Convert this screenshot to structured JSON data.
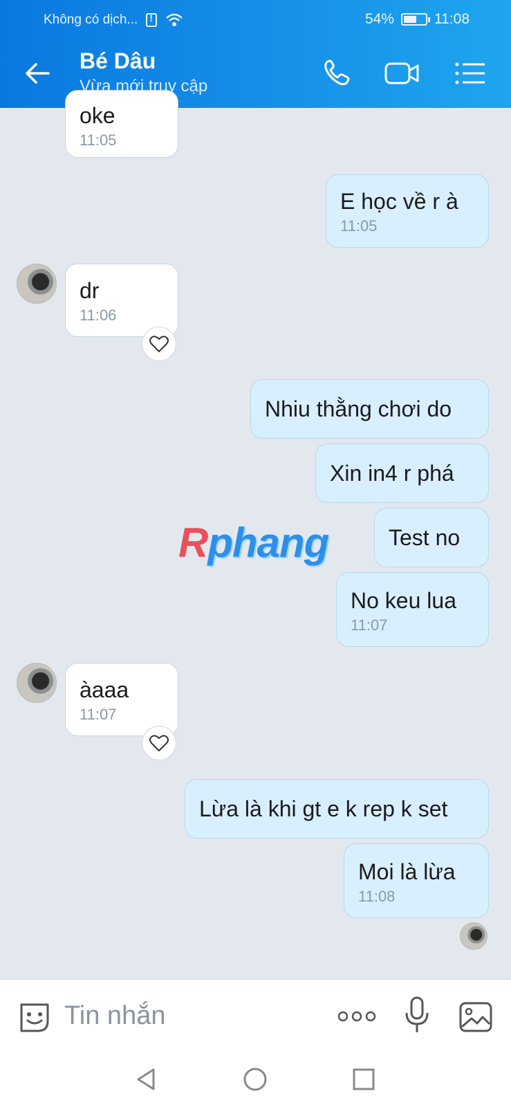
{
  "status_bar": {
    "carrier": "Không có dịch...",
    "battery": "54%",
    "time": "11:08"
  },
  "header": {
    "contact_name": "Bé Dâu",
    "contact_status": "Vừa mới truy cập"
  },
  "messages": [
    {
      "direction": "in",
      "text": "oke",
      "time": "11:05"
    },
    {
      "direction": "out",
      "text": "E học về r à",
      "time": "11:05"
    },
    {
      "direction": "in",
      "text": "dr",
      "time": "11:06"
    },
    {
      "direction": "out",
      "text": "Nhiu thằng chơi do"
    },
    {
      "direction": "out",
      "text": "Xin in4 r phá"
    },
    {
      "direction": "out",
      "text": "Test no"
    },
    {
      "direction": "out",
      "text": "No keu lua",
      "time": "11:07"
    },
    {
      "direction": "in",
      "text": "àaaa",
      "time": "11:07"
    },
    {
      "direction": "out",
      "text": "Lừa là khi gt e k rep k set"
    },
    {
      "direction": "out",
      "text": "Moi là lừa",
      "time": "11:08"
    }
  ],
  "watermark": {
    "first": "R",
    "rest": "phang"
  },
  "input_bar": {
    "placeholder": "Tin nhắn"
  },
  "colors": {
    "header": "#0a78e0",
    "outgoing_bubble": "#d8efff",
    "incoming_bubble": "#ffffff",
    "background": "#e3e8ef"
  }
}
